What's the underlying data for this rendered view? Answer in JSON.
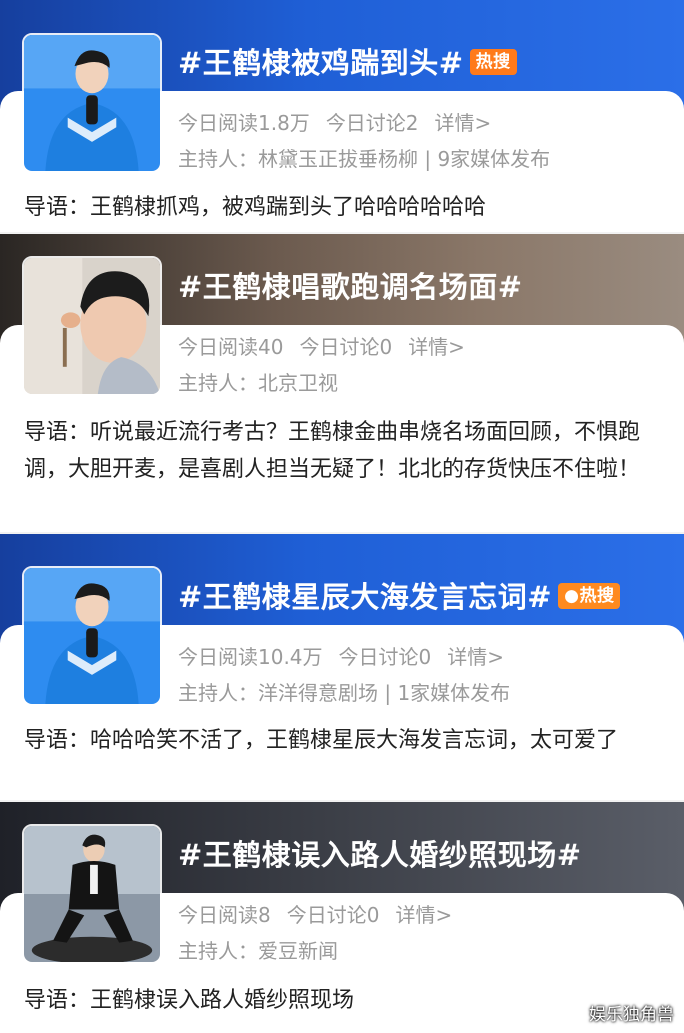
{
  "topics": [
    {
      "title": "#王鹤棣被鸡踹到头#",
      "badge": "热搜",
      "reads": "今日阅读1.8万",
      "discuss": "今日讨论2",
      "detail": "详情>",
      "host": "主持人：林黛玉正拔垂杨柳 | 9家媒体发布",
      "intro": "导语：王鹤棣抓鸡，被鸡踹到头了哈哈哈哈哈哈",
      "avatar_icon": "person-blue-jacket-mic"
    },
    {
      "title": "#王鹤棣唱歌跑调名场面#",
      "badge": "",
      "reads": "今日阅读40",
      "discuss": "今日讨论0",
      "detail": "详情>",
      "host": "主持人：北京卫视",
      "intro": "导语：听说最近流行考古？王鹤棣金曲串烧名场面回顾，不惧跑调，大胆开麦，是喜剧人担当无疑了！北北的存货快压不住啦！",
      "avatar_icon": "person-singing-closeup"
    },
    {
      "title": "#王鹤棣星辰大海发言忘词#",
      "badge": "热搜",
      "reads": "今日阅读10.4万",
      "discuss": "今日讨论0",
      "detail": "详情>",
      "host": "主持人：洋洋得意剧场 | 1家媒体发布",
      "intro": "导语：哈哈哈笑不活了，王鹤棣星辰大海发言忘词，太可爱了",
      "avatar_icon": "person-blue-jacket-mic"
    },
    {
      "title": "#王鹤棣误入路人婚纱照现场#",
      "badge": "",
      "reads": "今日阅读8",
      "discuss": "今日讨论0",
      "detail": "详情>",
      "host": "主持人：爱豆新闻",
      "intro": "导语：王鹤棣误入路人婚纱照现场",
      "avatar_icon": "person-suit-crouching"
    }
  ],
  "watermark": "娱乐独角兽",
  "colors": {
    "banner_blue": "#1f5fd6",
    "banner_brown": "#6b5a4e",
    "banner_dark": "#3a3d45",
    "hot_badge": "#ff7a1a",
    "stats_text": "#9a9a9a"
  }
}
